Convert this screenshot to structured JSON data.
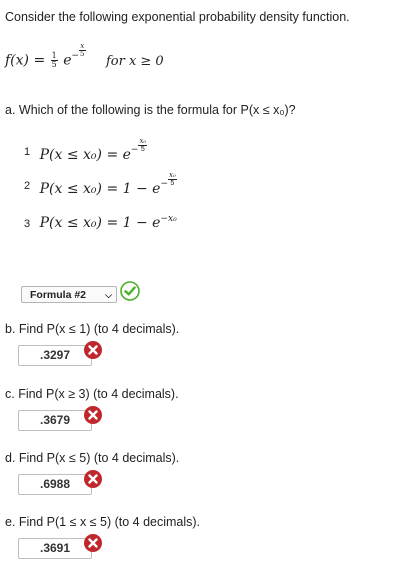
{
  "intro": "Consider the following exponential probability density function.",
  "pdf": {
    "lhs": "f(x) = ",
    "coef_num": "1",
    "coef_den": "5",
    "base": "e",
    "exp_sign": "−",
    "exp_num": "x",
    "exp_den": "5",
    "cond": "for  x ≥ 0"
  },
  "part_a": {
    "question": "a. Which of the following is the formula for P(x ≤ x₀)?",
    "options": [
      {
        "num": "1",
        "text": "P(x ≤ x₀) = e",
        "exp_num": "x₀",
        "exp_den": "5",
        "exp_sign": "−"
      },
      {
        "num": "2",
        "text": "P(x ≤ x₀) = 1 − e",
        "exp_num": "x₀",
        "exp_den": "5",
        "exp_sign": "−"
      },
      {
        "num": "3",
        "text": "P(x ≤ x₀) = 1 − e",
        "exp_plain": "−x₀"
      }
    ],
    "selected": "Formula #2",
    "status": "correct"
  },
  "part_b": {
    "question": "b. Find P(x ≤ 1) (to 4 decimals).",
    "answer": ".3297",
    "status": "incorrect"
  },
  "part_c": {
    "question": "c. Find P(x ≥ 3) (to 4 decimals).",
    "answer": ".3679",
    "status": "incorrect"
  },
  "part_d": {
    "question": "d. Find P(x ≤ 5) (to 4 decimals).",
    "answer": ".6988",
    "status": "incorrect"
  },
  "part_e": {
    "question": "e. Find P(1 ≤ x ≤ 5) (to 4 decimals).",
    "answer": ".3691",
    "status": "incorrect"
  },
  "colors": {
    "correct": "#4caf2a",
    "incorrect": "#c0272d"
  },
  "icons": {
    "correct": "checkmark-circle-icon",
    "incorrect": "x-circle-icon"
  }
}
